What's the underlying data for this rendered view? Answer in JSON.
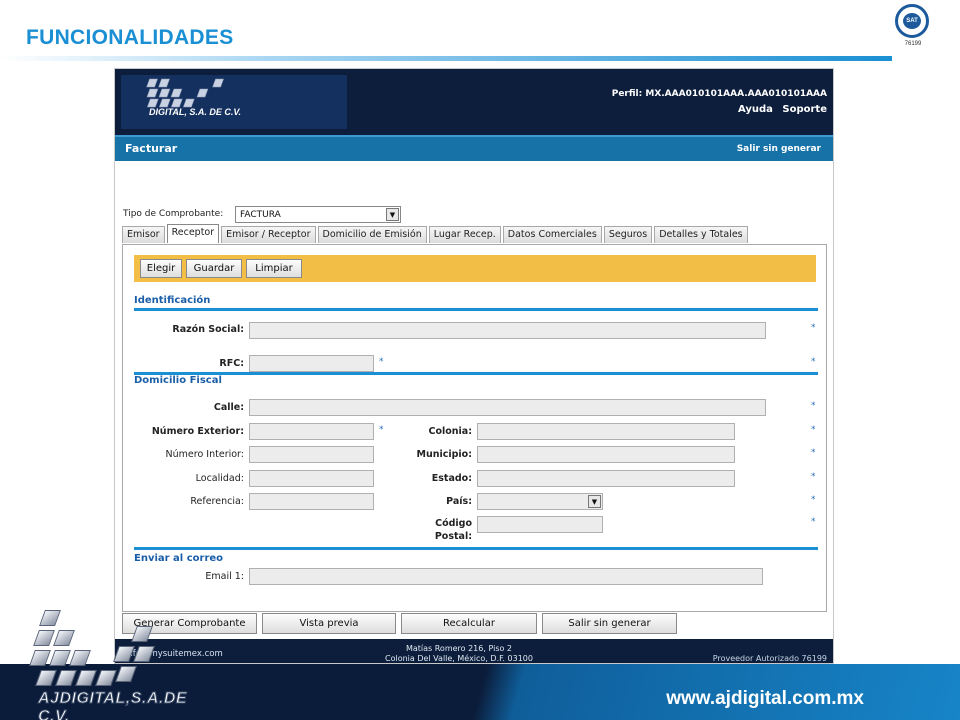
{
  "slide": {
    "title": "FUNCIONALIDADES",
    "sat_logo_text": "SAT",
    "sat_number": "76199",
    "website": "www.ajdigital.com.mx",
    "brand_text": "AJDIGITAL,S.A.DE C.V."
  },
  "app": {
    "logo_text": "DIGITAL, S.A. DE C.V.",
    "profile": "Perfil: MX.AAA010101AAA.AAA010101AAA",
    "links": [
      "Ayuda",
      "Soporte"
    ],
    "nav_title": "Facturar",
    "nav_exit": "Salir sin generar",
    "tipo_label": "Tipo de Comprobante:",
    "tipo_value": "FACTURA",
    "tabs": [
      "Emisor",
      "Receptor",
      "Emisor / Receptor",
      "Domicilio de Emisión",
      "Lugar Recep.",
      "Datos Comerciales",
      "Seguros",
      "Detalles y Totales"
    ],
    "active_tab": "Receptor",
    "toolbar": {
      "elegir": "Elegir",
      "guardar": "Guardar",
      "limpiar": "Limpiar"
    },
    "sections": {
      "identificacion": "Identificación",
      "domicilio": "Domicilio Fiscal",
      "correo": "Enviar al correo"
    },
    "fields": {
      "razon_social": "Razón Social:",
      "rfc": "RFC:",
      "calle": "Calle:",
      "numero_exterior": "Número Exterior:",
      "numero_interior": "Número Interior:",
      "localidad": "Localidad:",
      "referencia": "Referencia:",
      "colonia": "Colonia:",
      "municipio": "Municipio:",
      "estado": "Estado:",
      "pais": "País:",
      "codigo": "Código",
      "postal": "Postal:",
      "email1": "Email 1:"
    },
    "required_mark": "*",
    "actions": [
      "Generar Comprobante",
      "Vista previa",
      "Recalcular",
      "Salir sin generar"
    ],
    "footer": {
      "email": "info@mysuitemex.com",
      "address_line1": "Matías Romero 216, Piso 2",
      "address_line2": "Colonia Del Valle, México, D.F. 03100",
      "provider": "Proveedor Autorizado 76199"
    }
  },
  "colors": {
    "accent": "#1a8fd3",
    "header_dark": "#0c1e3c",
    "toolbar_yellow": "#f2be45",
    "section_blue": "#1b5ea8"
  }
}
